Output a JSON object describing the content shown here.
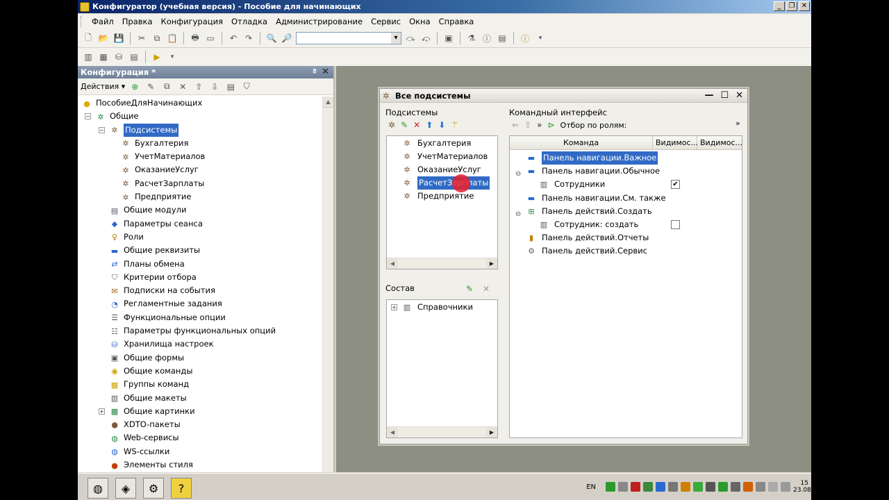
{
  "window": {
    "title": "Конфигуратор (учебная версия) - Пособие для начинающих"
  },
  "menu": [
    "Файл",
    "Правка",
    "Конфигурация",
    "Отладка",
    "Администрирование",
    "Сервис",
    "Окна",
    "Справка"
  ],
  "left_panel": {
    "title": "Конфигурация *",
    "actions_label": "Действия",
    "tree": [
      {
        "label": "ПособиеДляНачинающих",
        "icon": "config-icon",
        "level": 0
      },
      {
        "label": "Общие",
        "icon": "common-icon",
        "level": 1,
        "expander": "−"
      },
      {
        "label": "Подсистемы",
        "icon": "subsystem-icon",
        "level": 2,
        "expander": "−",
        "selected": true
      },
      {
        "label": "Бухгалтерия",
        "icon": "subsystem-icon",
        "level": 3
      },
      {
        "label": "УчетМатериалов",
        "icon": "subsystem-icon",
        "level": 3
      },
      {
        "label": "ОказаниеУслуг",
        "icon": "subsystem-icon",
        "level": 3
      },
      {
        "label": "РасчетЗарплаты",
        "icon": "subsystem-icon",
        "level": 3
      },
      {
        "label": "Предприятие",
        "icon": "subsystem-icon",
        "level": 3
      },
      {
        "label": "Общие модули",
        "icon": "module-icon",
        "level": 2
      },
      {
        "label": "Параметры сеанса",
        "icon": "param-icon",
        "level": 2
      },
      {
        "label": "Роли",
        "icon": "role-icon",
        "level": 2
      },
      {
        "label": "Общие реквизиты",
        "icon": "attr-icon",
        "level": 2
      },
      {
        "label": "Планы обмена",
        "icon": "exchange-icon",
        "level": 2
      },
      {
        "label": "Критерии отбора",
        "icon": "filter-icon",
        "level": 2
      },
      {
        "label": "Подписки на события",
        "icon": "event-icon",
        "level": 2
      },
      {
        "label": "Регламентные задания",
        "icon": "clock-icon",
        "level": 2
      },
      {
        "label": "Функциональные опции",
        "icon": "option-icon",
        "level": 2
      },
      {
        "label": "Параметры функциональных опций",
        "icon": "option-param-icon",
        "level": 2
      },
      {
        "label": "Хранилища настроек",
        "icon": "storage-icon",
        "level": 2
      },
      {
        "label": "Общие формы",
        "icon": "form-icon",
        "level": 2
      },
      {
        "label": "Общие команды",
        "icon": "command-icon",
        "level": 2
      },
      {
        "label": "Группы команд",
        "icon": "folder-icon",
        "level": 2
      },
      {
        "label": "Общие макеты",
        "icon": "template-icon",
        "level": 2
      },
      {
        "label": "Общие картинки",
        "icon": "picture-icon",
        "level": 2,
        "expander": "+"
      },
      {
        "label": "XDTO-пакеты",
        "icon": "xdto-icon",
        "level": 2
      },
      {
        "label": "Web-сервисы",
        "icon": "web-icon",
        "level": 2
      },
      {
        "label": "WS-ссылки",
        "icon": "ws-icon",
        "level": 2
      },
      {
        "label": "Элементы стиля",
        "icon": "style-icon",
        "level": 2
      }
    ]
  },
  "dialog": {
    "title": "Все подсистемы",
    "subsystems_label": "Подсистемы",
    "subsystems": [
      "Бухгалтерия",
      "УчетМатериалов",
      "ОказаниеУслуг",
      "РасчетЗарплаты",
      "Предприятие"
    ],
    "selected_subsystem_index": 3,
    "composition_label": "Состав",
    "composition": [
      {
        "label": "Справочники"
      }
    ],
    "command_interface_label": "Командный интерфейс",
    "filter_by_roles": "Отбор по ролям:",
    "columns": [
      "Команда",
      "Видимос...",
      "Видимос..."
    ],
    "commands": [
      {
        "label": "Панель навигации.Важное",
        "level": 0,
        "selected": true,
        "icon": "nav-panel-icon"
      },
      {
        "label": "Панель навигации.Обычное",
        "level": 0,
        "expander": "−",
        "icon": "nav-panel-icon"
      },
      {
        "label": "Сотрудники",
        "level": 1,
        "icon": "table-icon",
        "checked": true
      },
      {
        "label": "Панель навигации.См. также",
        "level": 0,
        "icon": "nav-panel-icon"
      },
      {
        "label": "Панель действий.Создать",
        "level": 0,
        "expander": "−",
        "icon": "create-icon"
      },
      {
        "label": "Сотрудник: создать",
        "level": 1,
        "icon": "table-icon",
        "checked": false
      },
      {
        "label": "Панель действий.Отчеты",
        "level": 0,
        "icon": "reports-icon"
      },
      {
        "label": "Панель действий.Сервис",
        "level": 0,
        "icon": "gear-icon"
      }
    ]
  },
  "taskbar": {
    "lang": "EN",
    "time": "15",
    "date": "23.08"
  },
  "colors": {
    "selection": "#316ac5",
    "workspace": "#8d8f82",
    "cursor_highlight": "#e8202a"
  }
}
